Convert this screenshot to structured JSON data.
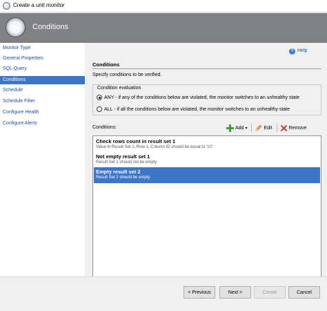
{
  "window": {
    "title": "Create a unit monitor"
  },
  "banner": {
    "heading": "Conditions"
  },
  "sidebar": {
    "items": [
      {
        "label": "Monitor Type",
        "active": false
      },
      {
        "label": "General Properties",
        "active": false
      },
      {
        "label": "SQL Query",
        "active": false
      },
      {
        "label": "Conditions",
        "active": true
      },
      {
        "label": "Schedule",
        "active": false
      },
      {
        "label": "Schedule Filter",
        "active": false
      },
      {
        "label": "Configure Health",
        "active": false
      },
      {
        "label": "Configure Alerts",
        "active": false
      }
    ]
  },
  "main": {
    "help_label": "Help",
    "section_title": "Conditions",
    "description": "Specify conditions to be verified.",
    "evaluation": {
      "legend": "Condition evaluation",
      "options": [
        {
          "label": "ANY - if any of the conditions below are violated, the monitor switches to an unhealthy state",
          "selected": true
        },
        {
          "label": "ALL - if all the conditions below are violated, the monitor switches to an unhealthy state",
          "selected": false
        }
      ]
    },
    "conditions_label": "Conditions:",
    "toolbar": {
      "add_label": "Add",
      "edit_label": "Edit",
      "remove_label": "Remove"
    },
    "conditions": [
      {
        "title": "Check rows count in result set 1",
        "detail": "Value in Result Set 1, Row 1, Column ID should be equal to '10'",
        "selected": false
      },
      {
        "title": "Not empty result set 1",
        "detail": "Result Set 1 should not be empty",
        "selected": false
      },
      {
        "title": "Empty result set 2",
        "detail": "Result Set 2 should be empty",
        "selected": true
      }
    ]
  },
  "footer": {
    "previous_label": "< Previous",
    "next_label": "Next >",
    "create_label": "Create",
    "cancel_label": "Cancel"
  },
  "colors": {
    "accent": "#3d76c6",
    "banner": "#7f8184",
    "link": "#1f4ea3"
  }
}
